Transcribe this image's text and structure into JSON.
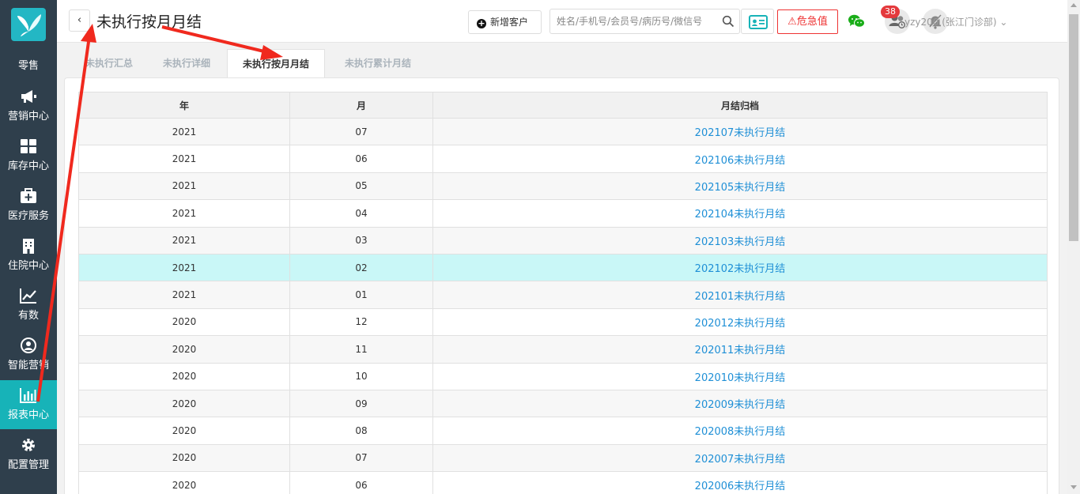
{
  "sidebar": {
    "items": [
      {
        "label": "零售",
        "icon": "retail-icon"
      },
      {
        "label": "营销中心",
        "icon": "megaphone-icon"
      },
      {
        "label": "库存中心",
        "icon": "grid-icon"
      },
      {
        "label": "医疗服务",
        "icon": "medical-kit-icon"
      },
      {
        "label": "住院中心",
        "icon": "hospital-icon"
      },
      {
        "label": "有数",
        "icon": "line-chart-icon"
      },
      {
        "label": "智能营销",
        "icon": "smart-marketing-icon"
      },
      {
        "label": "报表中心",
        "icon": "bar-chart-icon",
        "active": true
      },
      {
        "label": "配置管理",
        "icon": "gear-icon"
      }
    ]
  },
  "header": {
    "back_label": "‹",
    "title": "未执行按月月结",
    "new_customer_label": "新增客户",
    "search_placeholder": "姓名/手机号/会员号/病历号/微信号",
    "danger_label": "危急值",
    "notification_count": "38",
    "user_label": "yzy200 (张江门诊部) ⌄"
  },
  "tabs": [
    {
      "label": "未执行汇总",
      "active": false
    },
    {
      "label": "未执行详细",
      "active": false
    },
    {
      "label": "未执行按月月结",
      "active": true
    },
    {
      "label": "未执行累计月结",
      "active": false
    }
  ],
  "table": {
    "headers": [
      "年",
      "月",
      "月结归档"
    ],
    "rows": [
      {
        "year": "2021",
        "month": "07",
        "link": "202107未执行月结"
      },
      {
        "year": "2021",
        "month": "06",
        "link": "202106未执行月结"
      },
      {
        "year": "2021",
        "month": "05",
        "link": "202105未执行月结"
      },
      {
        "year": "2021",
        "month": "04",
        "link": "202104未执行月结"
      },
      {
        "year": "2021",
        "month": "03",
        "link": "202103未执行月结"
      },
      {
        "year": "2021",
        "month": "02",
        "link": "202102未执行月结",
        "highlight": true
      },
      {
        "year": "2021",
        "month": "01",
        "link": "202101未执行月结"
      },
      {
        "year": "2020",
        "month": "12",
        "link": "202012未执行月结"
      },
      {
        "year": "2020",
        "month": "11",
        "link": "202011未执行月结"
      },
      {
        "year": "2020",
        "month": "10",
        "link": "202010未执行月结"
      },
      {
        "year": "2020",
        "month": "09",
        "link": "202009未执行月结"
      },
      {
        "year": "2020",
        "month": "08",
        "link": "202008未执行月结"
      },
      {
        "year": "2020",
        "month": "07",
        "link": "202007未执行月结"
      },
      {
        "year": "2020",
        "month": "06",
        "link": "202006未执行月结"
      }
    ]
  },
  "colors": {
    "sidebar_bg": "#2f3f4c",
    "accent": "#17b3b8",
    "link": "#1e8fd6",
    "danger": "#e33",
    "highlight_row": "#c9f7f7",
    "annotation": "#f0291e"
  }
}
